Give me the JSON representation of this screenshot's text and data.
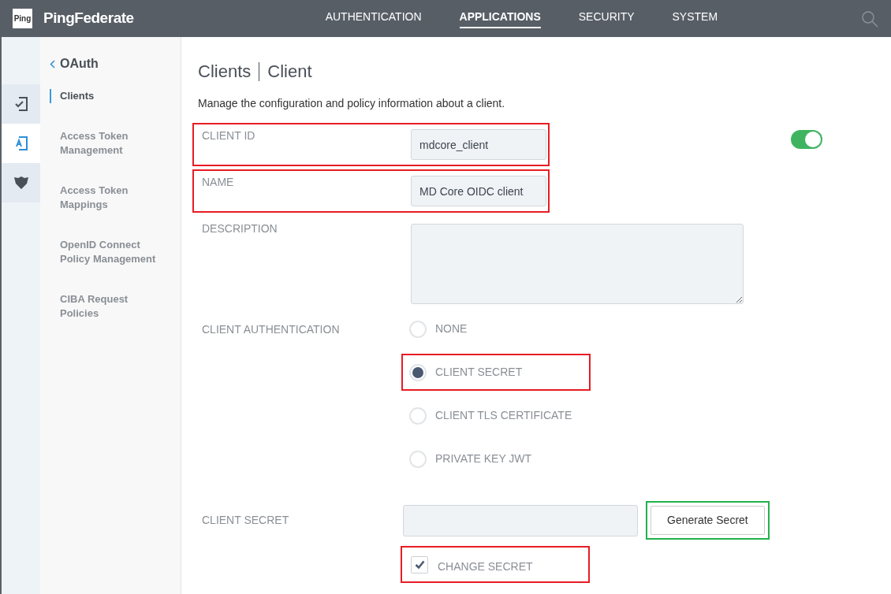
{
  "header": {
    "logo_badge": "Ping",
    "product": "PingFederate",
    "nav": [
      {
        "label": "AUTHENTICATION",
        "selected": false
      },
      {
        "label": "APPLICATIONS",
        "selected": true
      },
      {
        "label": "SECURITY",
        "selected": false
      },
      {
        "label": "SYSTEM",
        "selected": false
      }
    ]
  },
  "rail": [
    {
      "kind": "check",
      "selected": false
    },
    {
      "kind": "app",
      "selected": true
    },
    {
      "kind": "shield",
      "selected": false
    }
  ],
  "sidebar": {
    "back": "OAuth",
    "items": [
      {
        "label": "Clients",
        "selected": true
      },
      {
        "label": "Access Token Management",
        "selected": false
      },
      {
        "label": "Access Token Mappings",
        "selected": false
      },
      {
        "label": "OpenID Connect Policy Management",
        "selected": false
      },
      {
        "label": "CIBA Request Policies",
        "selected": false
      }
    ]
  },
  "page": {
    "breadcrumb": [
      "Clients",
      "Client"
    ],
    "description": "Manage the configuration and policy information about a client.",
    "enabled": true
  },
  "form": [
    {
      "kind": "text",
      "label": "CLIENT ID",
      "value": "mdcore_client",
      "color": "#e81c24"
    },
    {
      "kind": "text",
      "label": "NAME",
      "value": "MD Core OIDC client",
      "color": "#e81c24"
    },
    {
      "kind": "textarea",
      "label": "DESCRIPTION"
    },
    {
      "kind": "radio",
      "label": "CLIENT AUTHENTICATION",
      "options": [
        {
          "label": "NONE",
          "selected": false
        },
        {
          "label": "CLIENT SECRET",
          "selected": true,
          "color": "#e81c24"
        },
        {
          "label": "CLIENT TLS CERTIFICATE",
          "selected": false
        },
        {
          "label": "PRIVATE KEY JWT",
          "selected": false
        }
      ]
    },
    {
      "kind": "secret",
      "label": "CLIENT SECRET",
      "button": {
        "label": "Generate Secret",
        "color": "#22b14c"
      },
      "checkbox": {
        "label": "CHANGE SECRET",
        "checked": true,
        "color": "#e81c24"
      }
    }
  ]
}
